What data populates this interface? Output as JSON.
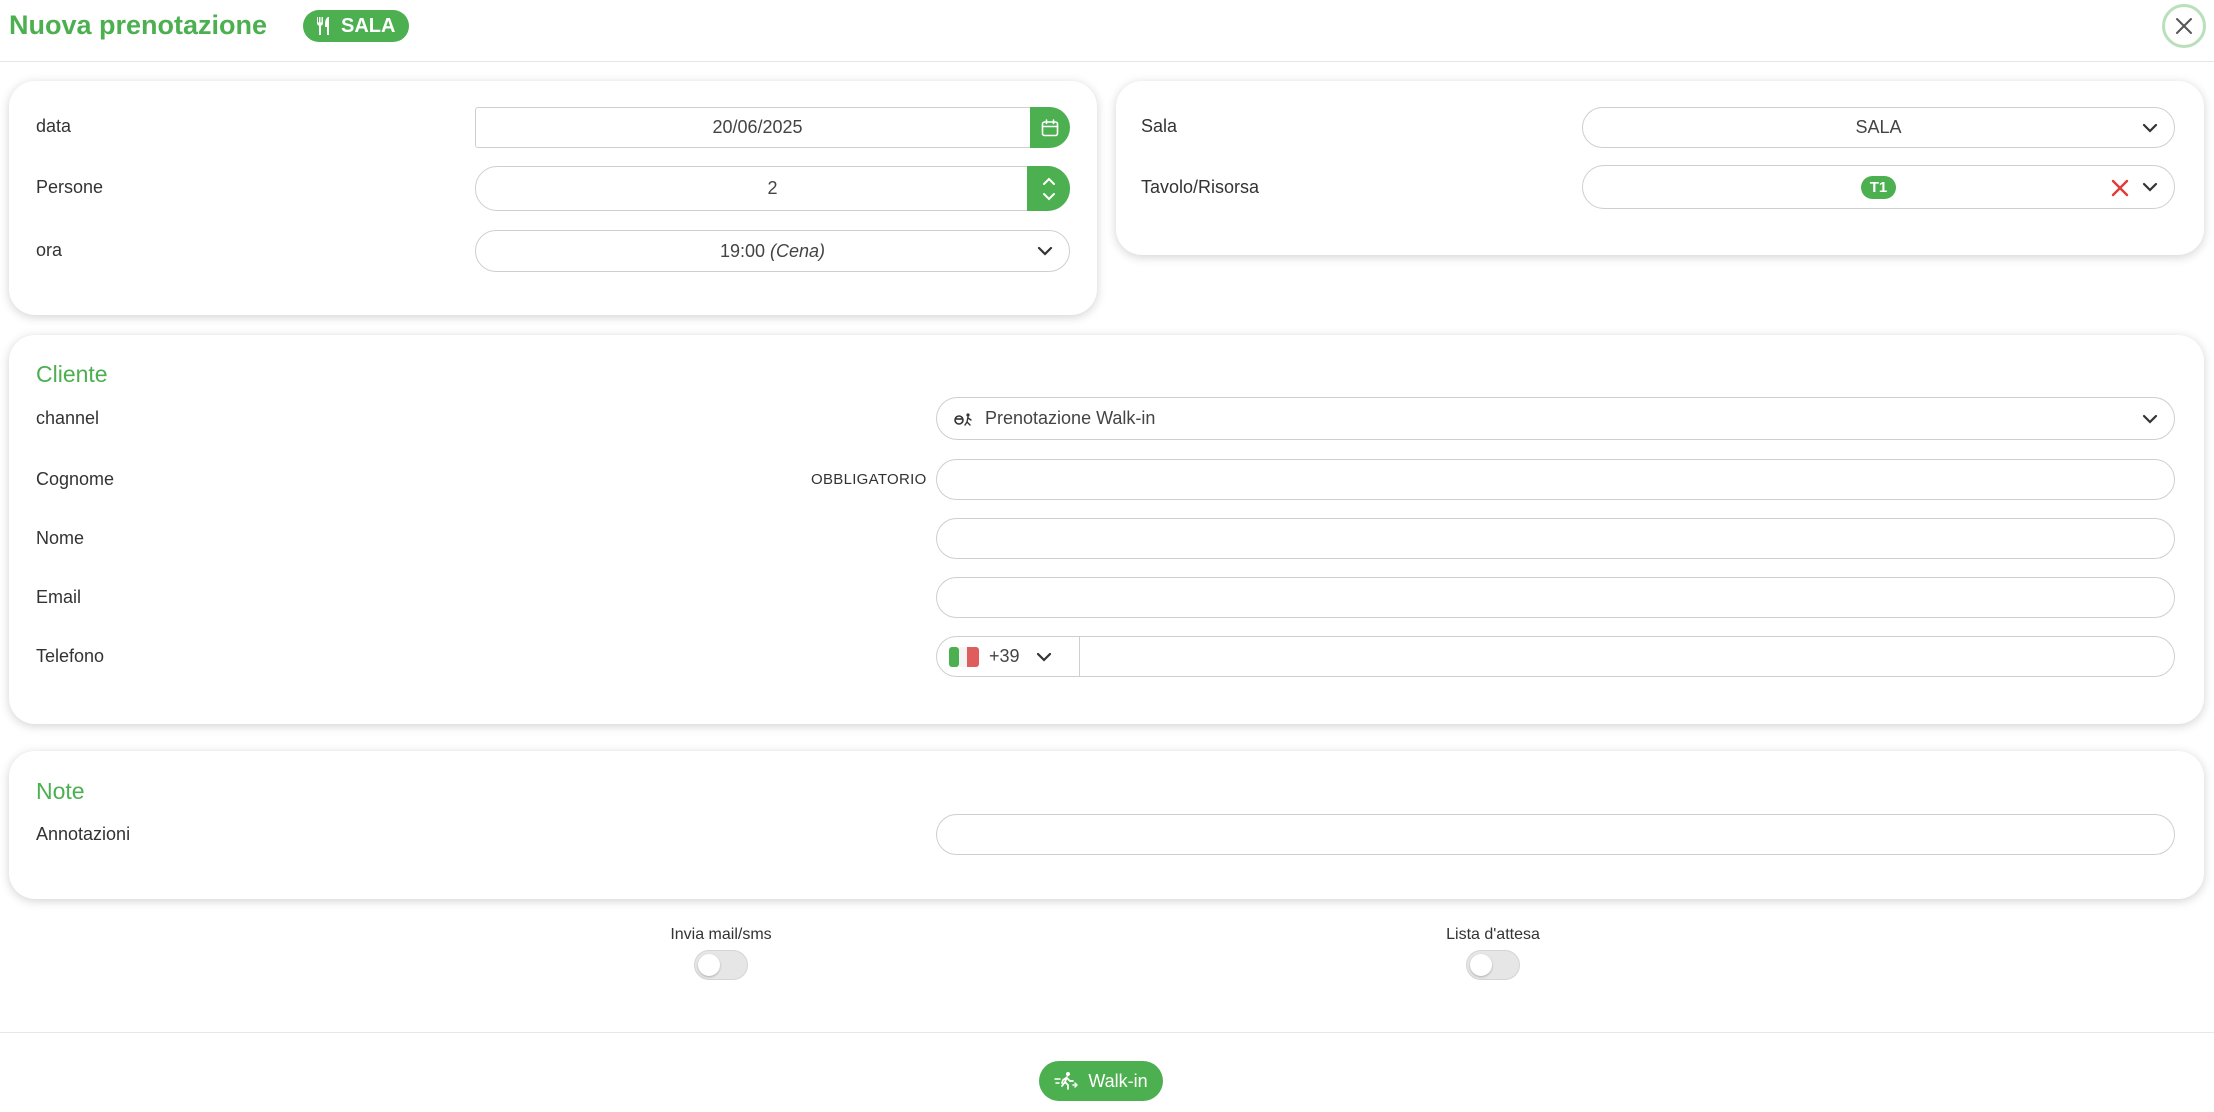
{
  "header": {
    "title": "Nuova prenotazione",
    "sala_badge": "SALA",
    "sala_icon": "fork-knife-icon",
    "close_icon": "close-icon"
  },
  "booking": {
    "date_label": "data",
    "date_value": "20/06/2025",
    "people_label": "Persone",
    "people_value": "2",
    "time_label": "ora",
    "time_value": "19:00",
    "time_service": "(Cena)"
  },
  "room": {
    "sala_label": "Sala",
    "sala_value": "SALA",
    "table_label": "Tavolo/Risorsa",
    "table_value": "T1"
  },
  "client": {
    "section_title": "Cliente",
    "channel_label": "channel",
    "channel_value": "Prenotazione Walk-in",
    "surname_label": "Cognome",
    "required_tag": "OBBLIGATORIO",
    "surname_value": "",
    "name_label": "Nome",
    "name_value": "",
    "email_label": "Email",
    "email_value": "",
    "phone_label": "Telefono",
    "phone_prefix": "+39",
    "phone_value": ""
  },
  "notes": {
    "section_title": "Note",
    "annotations_label": "Annotazioni",
    "annotations_value": ""
  },
  "toggles": {
    "send_label": "Invia mail/sms",
    "send_on": false,
    "waitlist_label": "Lista d'attesa",
    "waitlist_on": false
  },
  "footer": {
    "walkin_label": "Walk-in"
  },
  "colors": {
    "accent": "#4caf50",
    "clear_x": "#e53935"
  }
}
